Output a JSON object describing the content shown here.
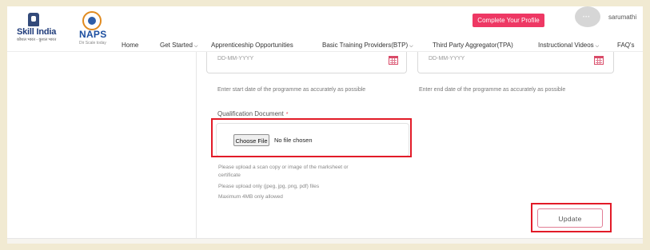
{
  "header": {
    "skill_logo_text": "Skill India",
    "skill_logo_sub": "कौशल भारत - कुशल भारत",
    "naps_logo_text": "NAPS",
    "naps_logo_sub": "Dir Scale today",
    "cta_label": "Complete Your Profile",
    "avatar_text": "•••",
    "username": "sarumathi",
    "nav": [
      {
        "label": "Home",
        "dropdown": false
      },
      {
        "label": "Get Started",
        "dropdown": true
      },
      {
        "label": "Apprenticeship Opportunities",
        "dropdown": false
      },
      {
        "label": "Basic Training Providers(BTP)",
        "dropdown": true
      },
      {
        "label": "Third Party Aggregator(TPA)",
        "dropdown": false
      },
      {
        "label": "Instructional Videos",
        "dropdown": true
      },
      {
        "label": "FAQ's",
        "dropdown": false
      }
    ]
  },
  "form": {
    "start_date_placeholder": "DD-MM-YYYY",
    "end_date_placeholder": "DD-MM-YYYY",
    "start_date_hint": "Enter start date of the programme as accurately as possible",
    "end_date_hint": "Enter end date of the programme as accurately as possible",
    "qualification_label": "Qualification Document",
    "required_mark": "*",
    "choose_file_label": "Choose File",
    "no_file_text": "No file chosen",
    "upload_note_1": "Please upload a scan copy or image of the marksheet or",
    "upload_note_2": "certificate",
    "upload_note_3": "Please upload only (jpeg, jpg, png, pdf) files",
    "upload_note_4": "Maximum 4MB only allowed",
    "update_label": "Update"
  },
  "colors": {
    "page_background": "#f1ead2",
    "cta_background": "#ee3864",
    "highlight_border": "#e21b28",
    "update_border": "#e27d95"
  },
  "icons": [
    "skill-india-emblem-icon",
    "naps-logo-icon",
    "calendar-icon",
    "chevron-down-icon",
    "avatar-icon"
  ]
}
